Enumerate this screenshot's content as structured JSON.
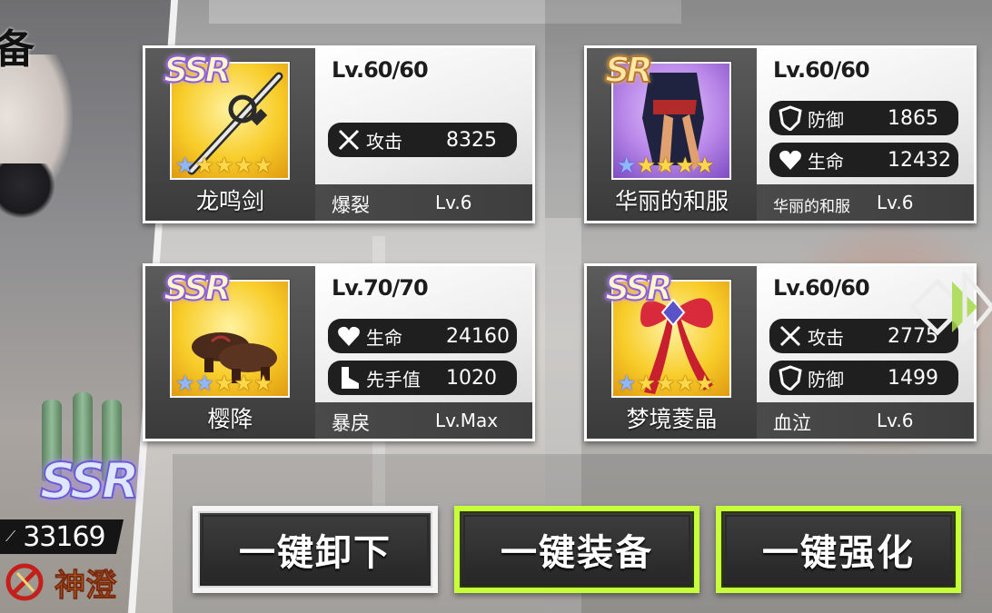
{
  "character": {
    "title_fragment": "备",
    "rarity": "SSR",
    "power": "33169",
    "name": "神澄"
  },
  "cards": [
    {
      "rarity": "SSR",
      "level": "Lv.60/60",
      "name": "龙鸣剑",
      "stars_blue": 1,
      "stars_total": 5,
      "stats": [
        {
          "icon": "swords-icon",
          "label": "攻击",
          "value": "8325"
        }
      ],
      "skill": "爆裂",
      "skill_level": "Lv.6"
    },
    {
      "rarity": "SR",
      "level": "Lv.60/60",
      "name": "华丽的和服",
      "stars_blue": 1,
      "stars_total": 5,
      "stats": [
        {
          "icon": "shield-icon",
          "label": "防御",
          "value": "1865"
        },
        {
          "icon": "heart-icon",
          "label": "生命",
          "value": "12432"
        }
      ],
      "skill": "华丽的和服",
      "skill_level": "Lv.6"
    },
    {
      "rarity": "SSR",
      "level": "Lv.70/70",
      "name": "樱降",
      "stars_blue": 2,
      "stars_total": 5,
      "stats": [
        {
          "icon": "heart-icon",
          "label": "生命",
          "value": "24160"
        },
        {
          "icon": "boot-icon",
          "label": "先手值",
          "value": "1020"
        }
      ],
      "skill": "暴戾",
      "skill_level": "Lv.Max"
    },
    {
      "rarity": "SSR",
      "level": "Lv.60/60",
      "name": "梦境菱晶",
      "stars_blue": 1,
      "stars_total": 5,
      "stats": [
        {
          "icon": "swords-icon",
          "label": "攻击",
          "value": "2775"
        },
        {
          "icon": "shield-icon",
          "label": "防御",
          "value": "1499"
        }
      ],
      "skill": "血泣",
      "skill_level": "Lv.6"
    }
  ],
  "buttons": {
    "unequip_all": "一键卸下",
    "equip_all": "一键装备",
    "enhance_all": "一键强化"
  },
  "colors": {
    "accent_lime": "#c7ff3a",
    "star_gold": "#ffd84a",
    "star_blue": "#8fb7ff"
  }
}
